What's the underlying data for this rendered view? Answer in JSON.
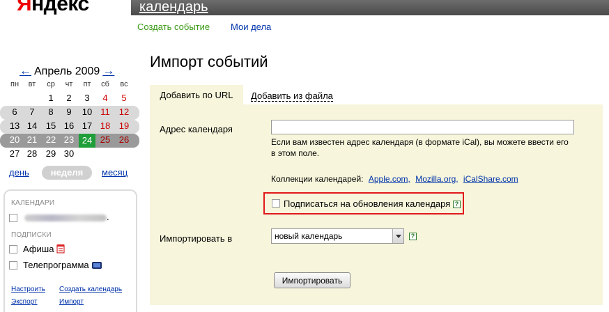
{
  "logo": {
    "first_letter": "Я",
    "rest": "ндекс"
  },
  "header": {
    "service_link": "календарь"
  },
  "subnav": {
    "create_event": "Создать событие",
    "my_tasks": "Мои дела"
  },
  "mini_calendar": {
    "prev": "←",
    "next": "→",
    "month_title": "Апрель 2009",
    "weekdays": [
      "пн",
      "вт",
      "ср",
      "чт",
      "пт",
      "сб",
      "вс"
    ],
    "weeks": [
      [
        "",
        "",
        "1",
        "2",
        "3",
        "4",
        "5"
      ],
      [
        "6",
        "7",
        "8",
        "9",
        "10",
        "11",
        "12"
      ],
      [
        "13",
        "14",
        "15",
        "16",
        "17",
        "18",
        "19"
      ],
      [
        "20",
        "21",
        "22",
        "23",
        "24",
        "25",
        "26"
      ],
      [
        "27",
        "28",
        "29",
        "30",
        "",
        "",
        ""
      ]
    ],
    "today": "24"
  },
  "views": {
    "day": "день",
    "week": "неделя",
    "month": "месяц"
  },
  "sidebar": {
    "calendars_header": "КАЛЕНДАРИ",
    "calendar_item_suffix": ".",
    "subscriptions_header": "ПОДПИСКИ",
    "subscriptions": [
      "Афиша",
      "Телепрограмма"
    ],
    "links": {
      "configure": "Настроить",
      "create_calendar": "Создать календарь",
      "export": "Экспорт",
      "import": "Импорт"
    }
  },
  "main": {
    "title": "Импорт событий",
    "tabs": {
      "by_url": "Добавить по URL",
      "from_file": "Добавить из файла"
    },
    "address_label": "Адрес календаря",
    "address_value": "",
    "address_hint": "Если вам известен адрес календаря (в формате iCal), вы можете ввести его в этом поле.",
    "collections_label": "Коллекции календарей:",
    "collections": [
      "Apple.com,",
      "Mozilla.org,",
      "iCalShare.com"
    ],
    "subscribe_label": "Подписаться на обновления календаря",
    "help_glyph": "?",
    "import_into_label": "Импортировать в",
    "import_into_value": "новый календарь",
    "import_button": "Импортировать"
  },
  "colors": {
    "accent_green": "#1f9e3a",
    "link_blue": "#0033aa",
    "highlight_red": "#e11a1a",
    "panel_bg": "#f7f6dc"
  }
}
